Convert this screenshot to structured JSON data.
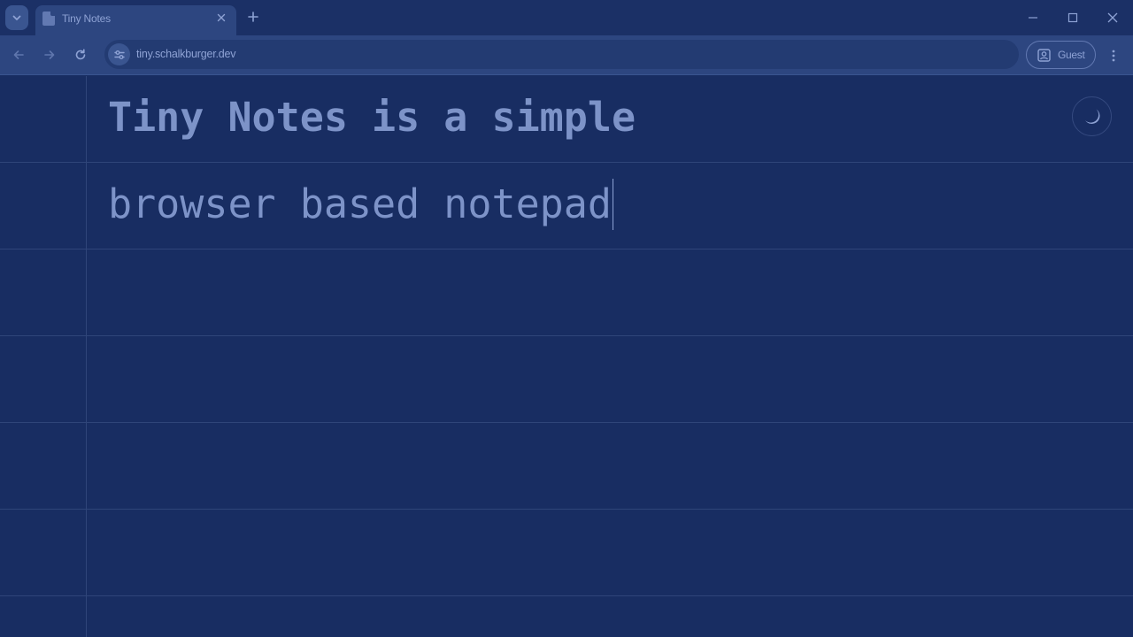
{
  "browser": {
    "tab": {
      "title": "Tiny Notes"
    },
    "new_tab_symbol": "+",
    "address_bar": {
      "url": "tiny.schalkburger.dev"
    },
    "profile": {
      "label": "Guest"
    }
  },
  "notes": {
    "lines": [
      {
        "text": "Tiny Notes is a simple",
        "bold": true
      },
      {
        "text": "browser based notepad",
        "bold": false
      }
    ]
  },
  "icons": {
    "tab_search": "chevron-down-icon",
    "favicon": "document-icon",
    "tab_close": "close-icon",
    "new_tab": "plus-icon",
    "minimize": "minimize-icon",
    "maximize": "maximize-icon",
    "close_window": "close-icon",
    "back": "arrow-left-icon",
    "forward": "arrow-right-icon",
    "reload": "reload-icon",
    "site_info": "tune-icon",
    "guest": "person-icon",
    "menu": "kebab-menu-icon",
    "theme_toggle": "moon-icon"
  },
  "colors": {
    "background": "#182d62",
    "text": "#7d93c8",
    "rule_lines": "#2f4579",
    "toolbar": "#2d4680"
  }
}
